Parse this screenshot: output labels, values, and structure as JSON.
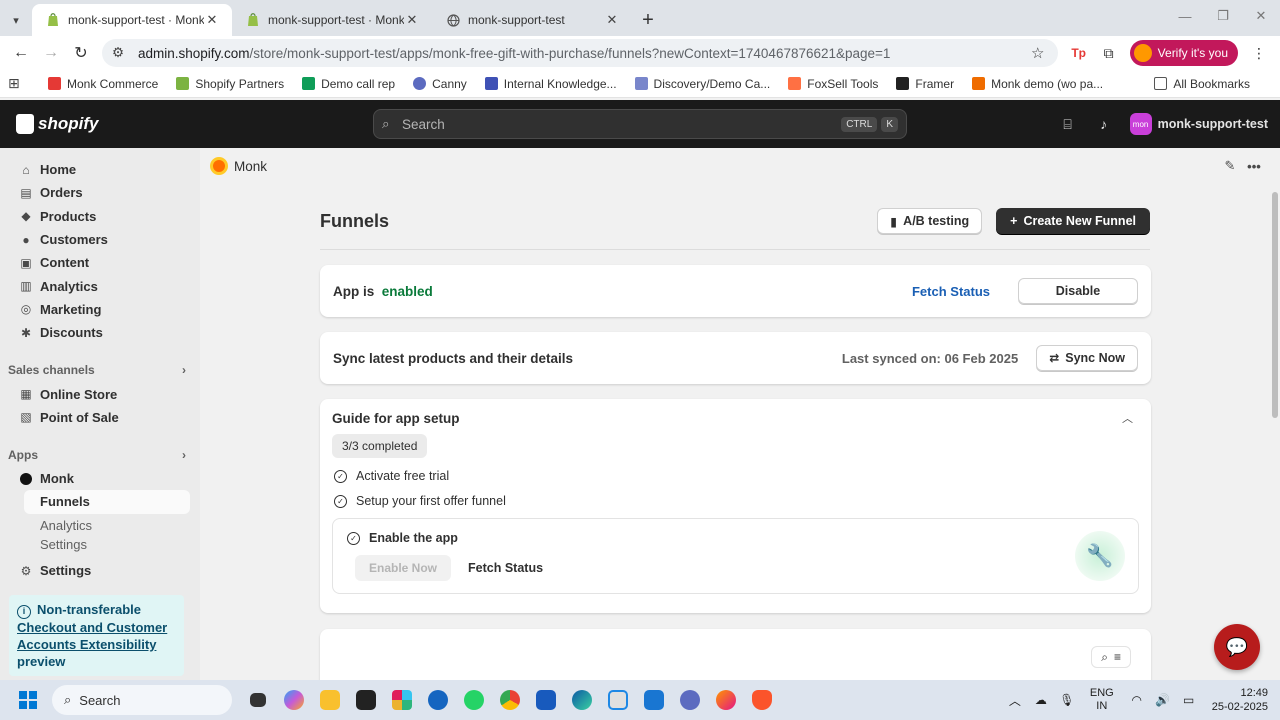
{
  "browser": {
    "tabs": [
      {
        "title": "monk-support-test · Monk · Sho",
        "active": true
      },
      {
        "title": "monk-support-test · Monk · Sho",
        "active": false
      },
      {
        "title": "monk-support-test",
        "active": false
      }
    ],
    "url_host": "admin.shopify.com",
    "url_path": "/store/monk-support-test/apps/monk-free-gift-with-purchase/funnels?newContext=1740467876621&page=1",
    "verify_label": "Verify it's you",
    "bookmarks": [
      {
        "label": "Monk Commerce",
        "color": "#e53935"
      },
      {
        "label": "Shopify Partners",
        "color": "#7cb342"
      },
      {
        "label": "Demo call rep",
        "color": "#0f9d58"
      },
      {
        "label": "Canny",
        "color": "#5c6bc0"
      },
      {
        "label": "Internal Knowledge...",
        "color": "#3f51b5"
      },
      {
        "label": "Discovery/Demo Ca...",
        "color": "#7986cb"
      },
      {
        "label": "FoxSell Tools",
        "color": "#ff7043"
      },
      {
        "label": "Framer",
        "color": "#212121"
      },
      {
        "label": "Monk demo (wo pa...",
        "color": "#ef6c00"
      }
    ],
    "all_bookmarks": "All Bookmarks"
  },
  "shopify": {
    "logo_text": "shopify",
    "search_placeholder": "Search",
    "kbd_ctrl": "CTRL",
    "kbd_k": "K",
    "store_avatar": "mon",
    "store_name": "monk-support-test"
  },
  "sidebar": {
    "items": [
      {
        "label": "Home",
        "icon": "⌂"
      },
      {
        "label": "Orders",
        "icon": "▤"
      },
      {
        "label": "Products",
        "icon": "◆"
      },
      {
        "label": "Customers",
        "icon": "●"
      },
      {
        "label": "Content",
        "icon": "▣"
      },
      {
        "label": "Analytics",
        "icon": "▥"
      },
      {
        "label": "Marketing",
        "icon": "◎"
      },
      {
        "label": "Discounts",
        "icon": "✱"
      }
    ],
    "sales_channels_label": "Sales channels",
    "channels": [
      {
        "label": "Online Store",
        "icon": "▦"
      },
      {
        "label": "Point of Sale",
        "icon": "▧"
      }
    ],
    "apps_label": "Apps",
    "app_name": "Monk",
    "app_subitems": [
      "Funnels",
      "Analytics",
      "Settings"
    ],
    "settings_label": "Settings",
    "notice": {
      "line1": "Non-transferable",
      "link": "Checkout and Customer Accounts Extensibility",
      "line3": "preview"
    }
  },
  "app": {
    "name": "Monk",
    "page_title": "Funnels",
    "ab_testing_label": "A/B testing",
    "create_funnel_label": "Create New Funnel",
    "status": {
      "prefix": "App is",
      "value": "enabled",
      "fetch_label": "Fetch Status",
      "disable_label": "Disable"
    },
    "sync": {
      "title": "Sync latest products and their details",
      "last_synced": "Last synced on: 06 Feb 2025",
      "sync_label": "Sync Now"
    },
    "guide": {
      "title": "Guide for app setup",
      "progress": "3/3 completed",
      "steps": [
        "Activate free trial",
        "Setup your first offer funnel"
      ],
      "active_step": "Enable the app",
      "enable_label": "Enable Now",
      "fetch_label": "Fetch Status"
    }
  },
  "taskbar": {
    "search_label": "Search",
    "lang_line1": "ENG",
    "lang_line2": "IN",
    "time": "12:49",
    "date": "25-02-2025"
  },
  "colors": {
    "enabled_green": "#0a7a3a",
    "link_blue": "#1a5fb4",
    "primary_dark": "#303030",
    "shopify_bar": "#1a1a1a"
  }
}
